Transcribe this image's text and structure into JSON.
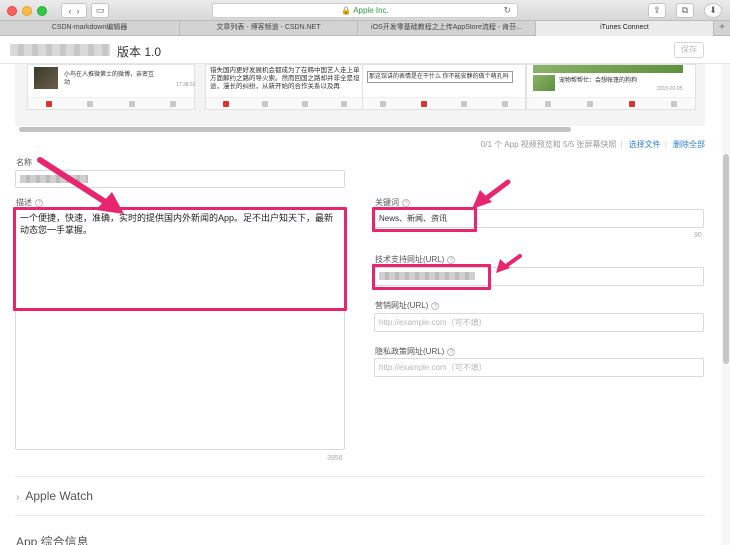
{
  "browser": {
    "address": "Apple Inc.",
    "tabs": [
      "CSDN-markdown编辑器",
      "文章列表 - 博客频道 - CSDN.NET",
      "iOS开发零基础教程之上传AppStore流程 - 肯芬...",
      "iTunes Connect"
    ]
  },
  "header": {
    "version_title": "版本 1.0",
    "save_label": "保存"
  },
  "screenshots": {
    "shot1_text": "小鸟在人推微第士的微博，亲密互动",
    "shot1_time": "17:38:32",
    "shot2_text": "错失国内更好发展机会都成为了在韩中国艺人走上单方面解约之路的导火索。然而回国之路却并非全是坦途，漫长的纠纷，从新开始的合作关系以及再",
    "shot3_text": "那这馆讲的表情是在干什么 你不能安静的做个萌孔吗",
    "shot4_text": "宠物帮帮忙：会想帐篷的狗狗",
    "shot4_time": "2015-02-05"
  },
  "media": {
    "count_text": "0/1 个 App 视频预览和 5/5 张屏幕快照",
    "choose_file": "选择文件",
    "delete_all": "删除全部"
  },
  "form": {
    "name_label": "名称",
    "description_label": "描述",
    "description_value": "一个便捷，快速，准确，实时的提供国内外新闻的App。足不出户知天下，最新动态您一手掌握。",
    "description_counter": "3956",
    "keywords_label": "关键词",
    "keywords_value": "News、新闻、资讯",
    "keywords_counter": "90",
    "support_url_label": "技术支持网址(URL)",
    "marketing_url_label": "营销网址(URL)",
    "marketing_url_placeholder": "http://example.com（可不填）",
    "privacy_url_label": "隐私政策网址(URL)",
    "privacy_url_placeholder": "http://example.com（可不填）"
  },
  "sections": {
    "apple_watch": "Apple Watch",
    "app_info": "App 综合信息"
  },
  "colors": {
    "highlight": "#e8256f",
    "link": "#2f7fd4"
  }
}
